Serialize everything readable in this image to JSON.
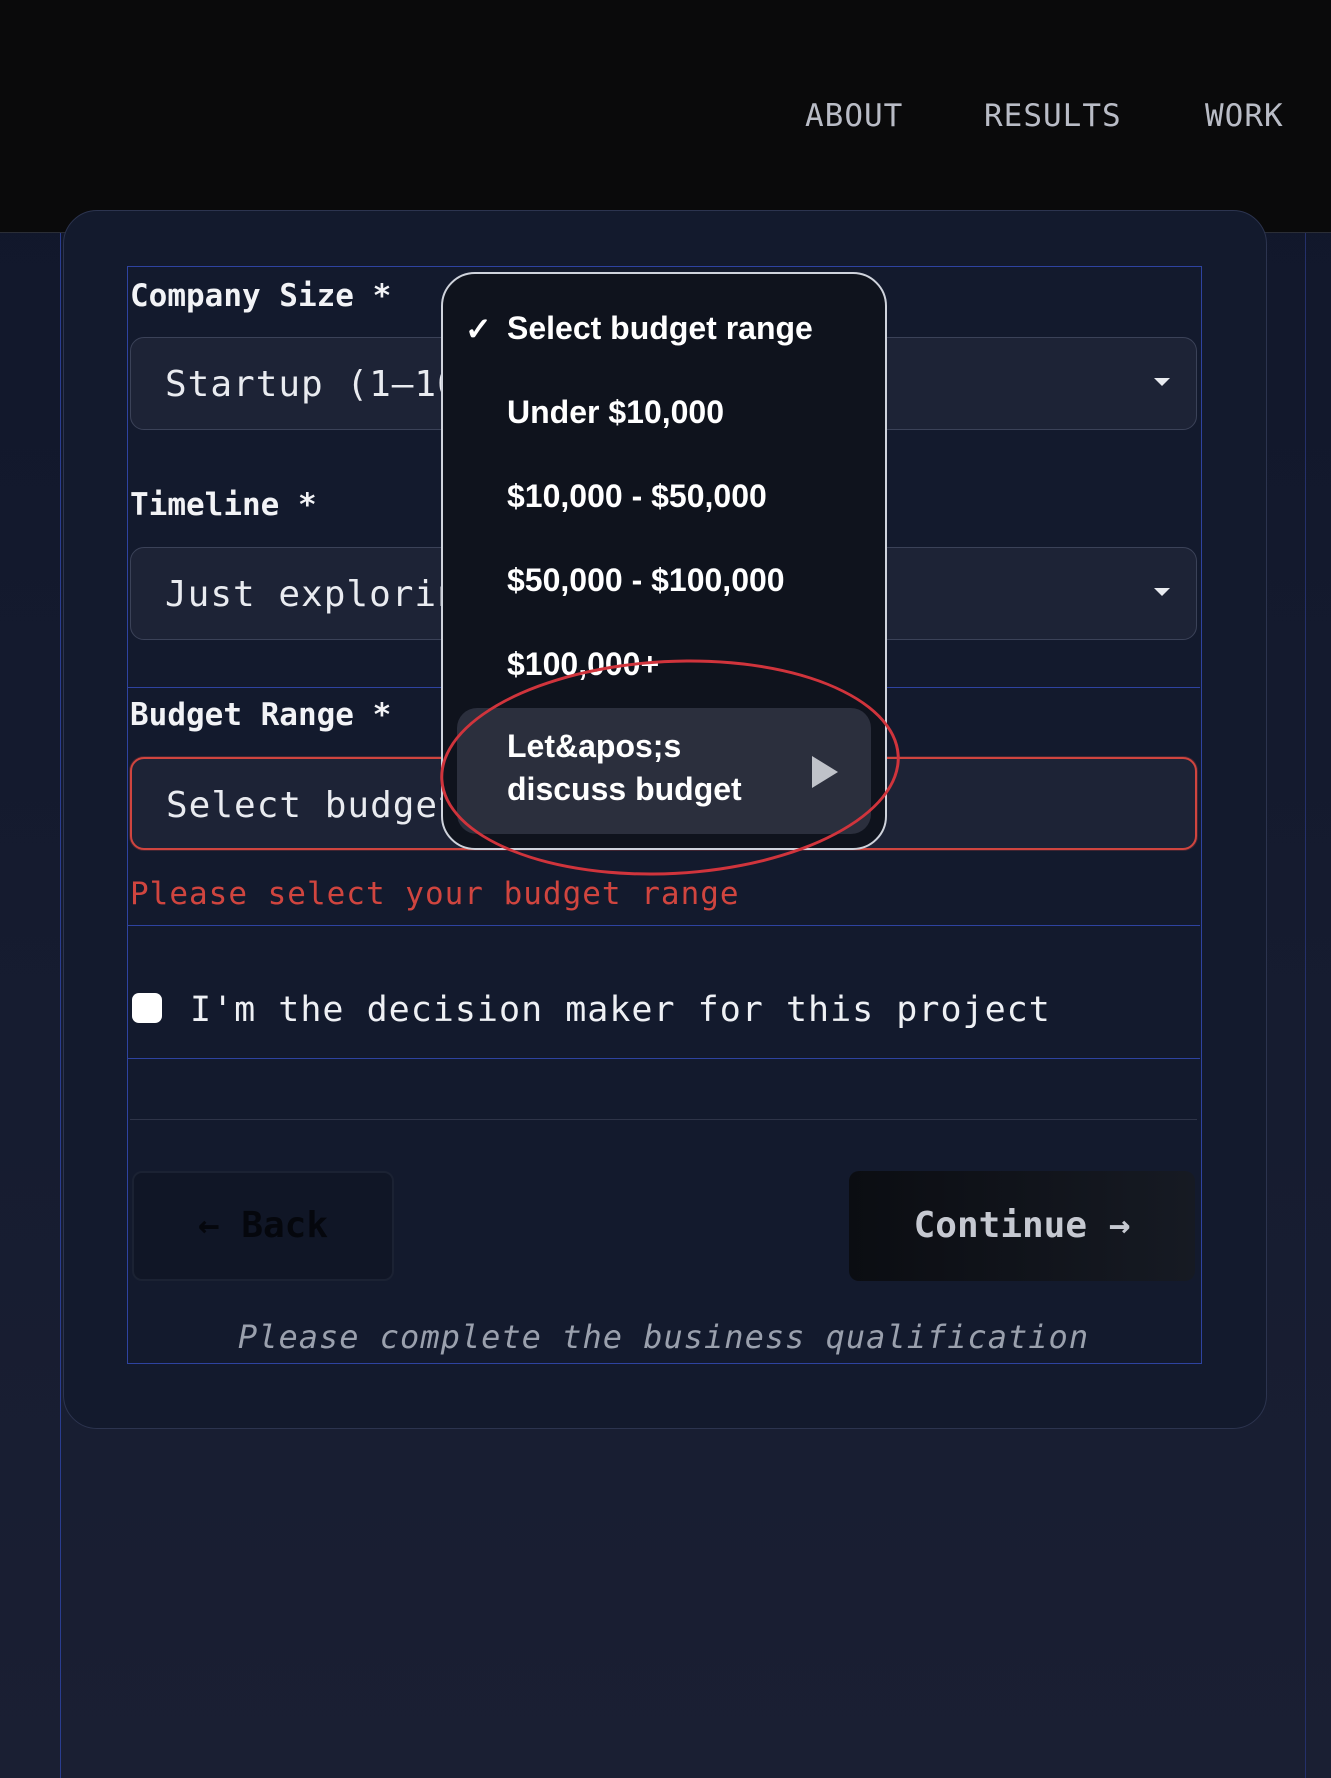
{
  "nav": {
    "links": [
      "ABOUT",
      "RESULTS",
      "WORK"
    ]
  },
  "form": {
    "company_size": {
      "label": "Company Size *",
      "value": "Startup (1–10"
    },
    "timeline": {
      "label": "Timeline *",
      "value": "Just explorin"
    },
    "budget": {
      "label": "Budget Range *",
      "value": "Select budget",
      "error": "Please select your budget range"
    },
    "decision_maker": {
      "label": "I'm the decision maker for this project",
      "checked": false
    },
    "back_label": "← Back",
    "continue_label": "Continue →",
    "hint": "Please complete the business qualification"
  },
  "dropdown": {
    "options": [
      {
        "label": "Select budget range",
        "selected": true
      },
      {
        "label": "Under $10,000"
      },
      {
        "label": "$10,000 - $50,000"
      },
      {
        "label": "$50,000 - $100,000"
      },
      {
        "label": "$100,000+"
      },
      {
        "label_line1": "Let&apos;s",
        "label_line2": "discuss budget",
        "hovered": true
      }
    ],
    "check_glyph": "✓"
  },
  "colors": {
    "error": "#d0453f",
    "annotation": "#d0343c",
    "accent_guide": "#2e43a0"
  }
}
